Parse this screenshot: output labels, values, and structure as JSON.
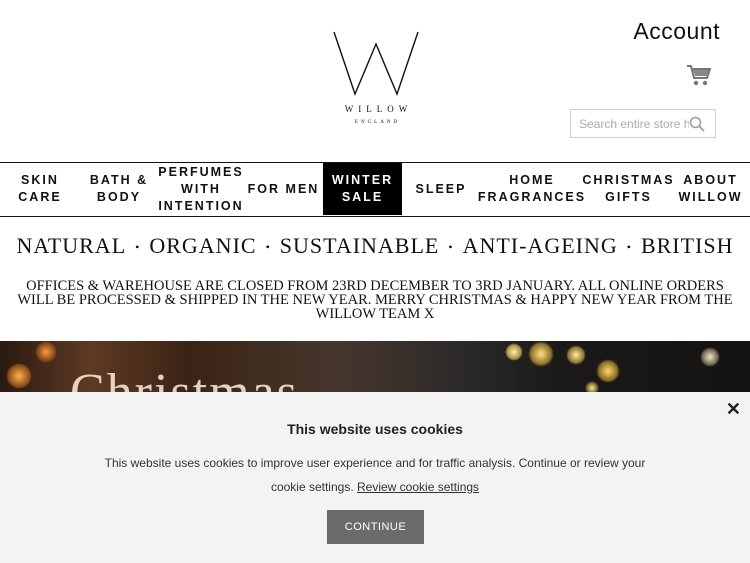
{
  "header": {
    "brand": "WILLOW",
    "brand_sub": "ENGLAND",
    "account_label": "Account",
    "cart_icon": "shopping-cart-icon",
    "search": {
      "placeholder": "Search entire store here...",
      "icon": "search-icon"
    }
  },
  "nav": {
    "items": [
      {
        "label": "SKIN\nCARE"
      },
      {
        "label": "BATH &\nBODY"
      },
      {
        "label": "PERFUMES\nWITH\nINTENTION"
      },
      {
        "label": "FOR MEN"
      },
      {
        "label": "WINTER\nSALE"
      },
      {
        "label": "SLEEP"
      },
      {
        "label": "HOME\nFRAGRANCES"
      },
      {
        "label": "CHRISTMAS\nGIFTS"
      },
      {
        "label": "ABOUT\nWILLOW"
      }
    ]
  },
  "tagline": [
    "NATURAL",
    "ORGANIC",
    "SUSTAINABLE",
    "ANTI-AGEING",
    "BRITISH"
  ],
  "notice": "OFFICES & WAREHOUSE ARE CLOSED FROM 23RD DECEMBER TO 3RD JANUARY. ALL ONLINE ORDERS WILL BE PROCESSED & SHIPPED IN THE NEW YEAR. MERRY CHRISTMAS & HAPPY NEW YEAR FROM THE WILLOW TEAM X",
  "hero": {
    "text": "Christmas"
  },
  "cookie": {
    "title": "This website uses cookies",
    "text": "This website uses cookies to improve user experience and for traffic analysis. Continue or review your cookie settings.",
    "link": "Review cookie settings",
    "button": "CONTINUE",
    "close": "✕"
  },
  "colors": {
    "active_nav_bg": "#000000",
    "cookie_bg": "#f3f3f3",
    "button_bg": "#6b6b6b"
  }
}
